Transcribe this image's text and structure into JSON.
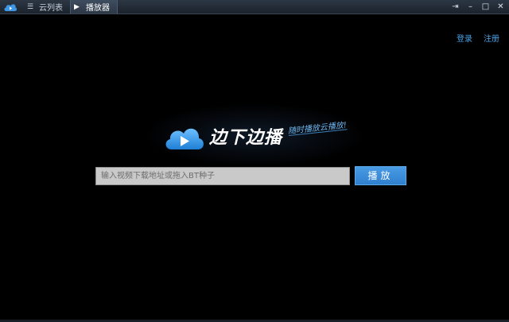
{
  "titlebar": {
    "app_icon": "cloud-play-icon",
    "tabs": [
      {
        "label": "云列表",
        "icon": "list-icon",
        "active": false
      },
      {
        "label": "播放器",
        "icon": "play-triangle-icon",
        "active": true
      }
    ],
    "controls": {
      "pin": "pin-icon",
      "minimize": "minimize-icon",
      "maximize": "maximize-icon",
      "close": "close-icon"
    }
  },
  "auth": {
    "login_label": "登录",
    "register_label": "注册"
  },
  "brand": {
    "name": "边下边播",
    "slogan": "随时播放云播放!",
    "logo_icon": "cloud-play-icon"
  },
  "search": {
    "placeholder": "输入视频下载地址或拖入BT种子",
    "value": "",
    "button_label": "播放"
  },
  "colors": {
    "background": "#000000",
    "accent": "#3a8fdc",
    "link": "#4aa3e8"
  }
}
